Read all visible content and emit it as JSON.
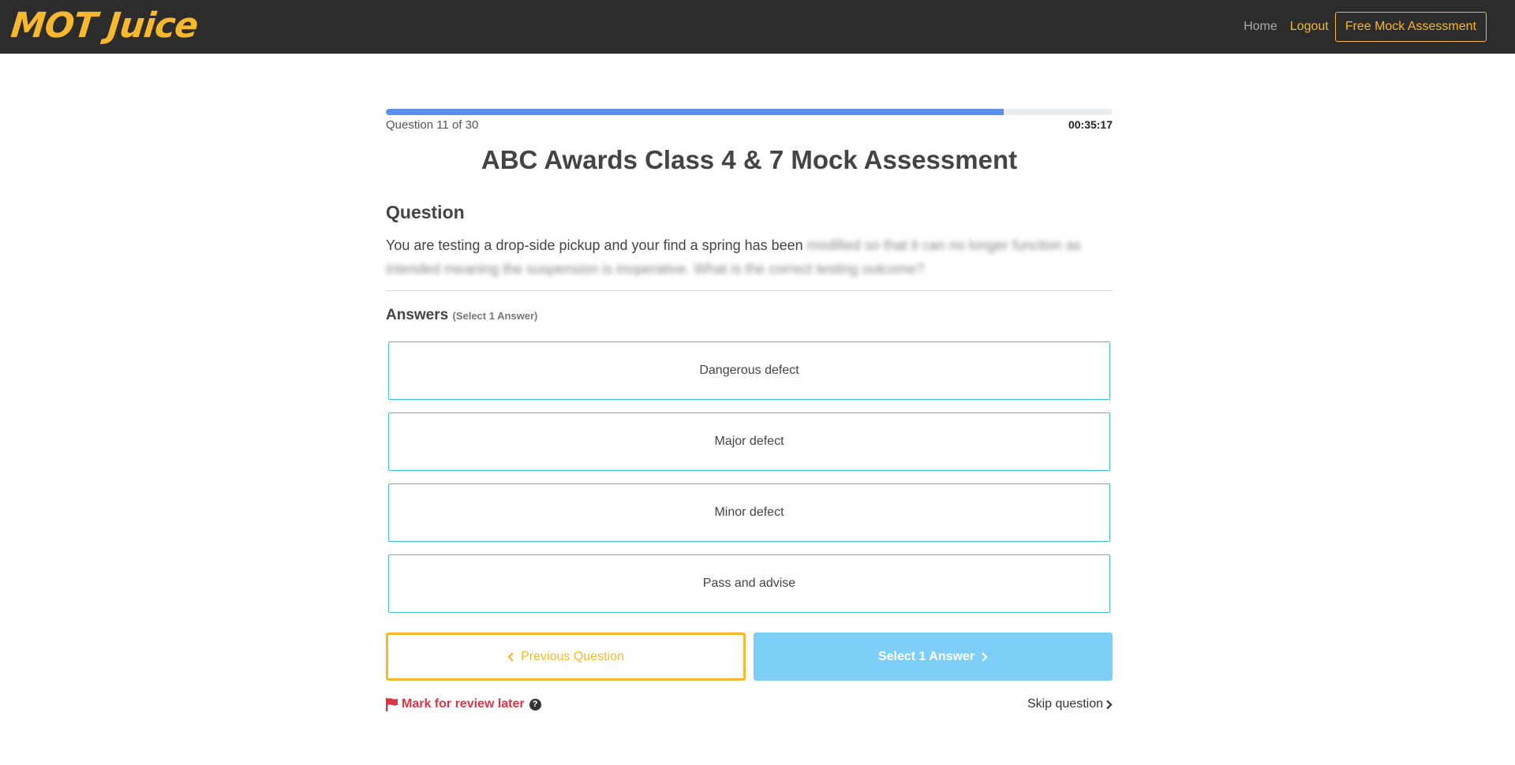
{
  "nav": {
    "brand": "MOT Juice",
    "home": "Home",
    "logout": "Logout",
    "cta": "Free Mock Assessment"
  },
  "progress": {
    "label": "Question 11 of 30",
    "fraction": 0.85,
    "timer": "00:35:17"
  },
  "assessment": {
    "title": "ABC Awards Class 4 & 7 Mock Assessment"
  },
  "question": {
    "heading": "Question",
    "text_visible": "You are testing a drop-side pickup and your find a spring has been",
    "text_blurred": "modified so that it can no longer function as intended meaning the suspension is inoperative. What is the correct testing outcome?"
  },
  "answers": {
    "heading": "Answers",
    "hint": "(Select 1 Answer)",
    "options": [
      "Dangerous defect",
      "Major defect",
      "Minor defect",
      "Pass and advise"
    ]
  },
  "actions": {
    "previous": "Previous Question",
    "next": "Select 1 Answer",
    "mark_review": "Mark for review later",
    "help": "?",
    "skip": "Skip question"
  },
  "colors": {
    "brand": "#f5b82e",
    "navbar": "#2c2c2c",
    "progress": "#5b8def",
    "answer_border": "#3fc0d9",
    "next_button": "#7ecff8",
    "mark_review": "#dc3545"
  },
  "icons": {
    "prev": "chevron-left-icon",
    "next": "chevron-right-icon",
    "flag": "flag-icon",
    "help": "question-circle-icon",
    "skip": "chevron-right-icon"
  }
}
